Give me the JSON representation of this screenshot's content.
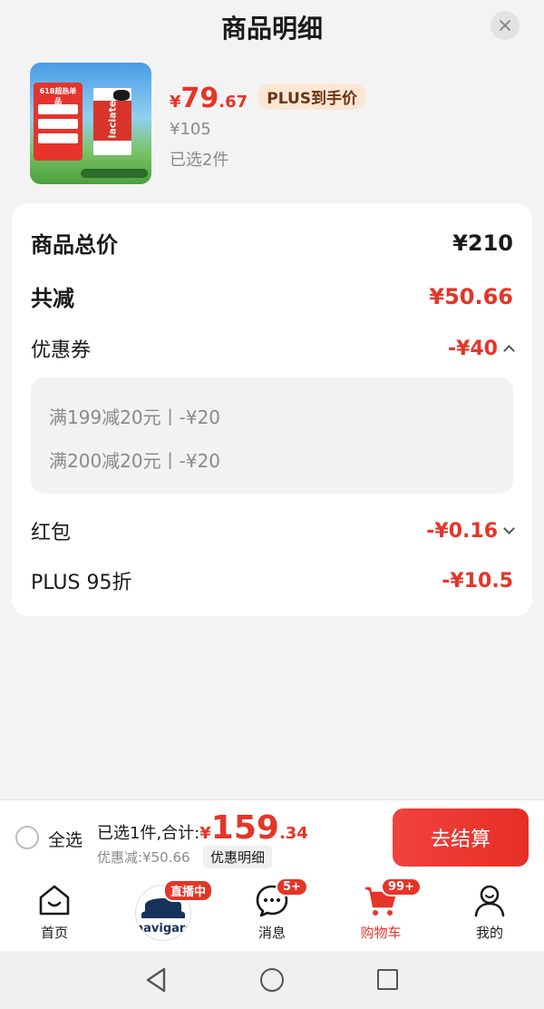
{
  "header": {
    "title": "商品明细",
    "close_icon": "close-icon"
  },
  "product": {
    "image_text": {
      "hot_label": "618超热单品",
      "brand": "laciate"
    },
    "price_symbol": "¥",
    "price_int": "79",
    "price_dec": ".67",
    "plus_badge": "PLUS到手价",
    "original_price": "¥105",
    "selected_qty": "已选2件"
  },
  "details": {
    "total_label": "商品总价",
    "total_value": "¥210",
    "reduce_label": "共减",
    "reduce_value": "¥50.66",
    "coupon_label": "优惠券",
    "coupon_value": "-¥40",
    "coupons": [
      "满199减20元丨-¥20",
      "满200减20元丨-¥20"
    ],
    "redpacket_label": "红包",
    "redpacket_value": "-¥0.16",
    "plus_label": "PLUS 95折",
    "plus_value": "-¥10.5"
  },
  "bottom_bar": {
    "select_all": "全选",
    "summary_prefix": "已选1件,合计:",
    "total_symbol": "¥",
    "total_int": "159",
    "total_dec": ".34",
    "discount_text": "优惠减:¥50.66",
    "detail_button": "优惠明细",
    "checkout_button": "去结算"
  },
  "tabbar": {
    "items": [
      {
        "label": "首页",
        "icon": "home-icon"
      },
      {
        "label": "",
        "icon": "live-avatar",
        "badge": "直播中",
        "avatar_text": "navigare"
      },
      {
        "label": "消息",
        "icon": "message-icon",
        "badge": "5+"
      },
      {
        "label": "购物车",
        "icon": "cart-icon",
        "badge": "99+",
        "active": true
      },
      {
        "label": "我的",
        "icon": "profile-icon"
      }
    ]
  },
  "colors": {
    "accent": "#e63428",
    "plus_badge_bg": "#fbe6d4",
    "background": "#f3f3f3"
  }
}
